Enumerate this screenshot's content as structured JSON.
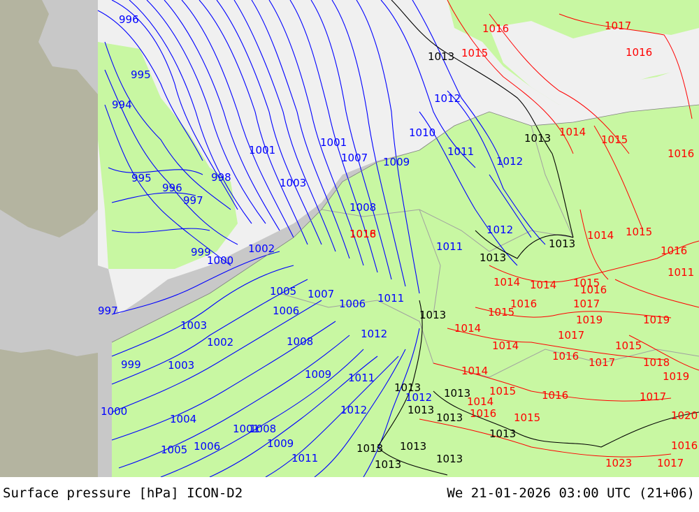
{
  "map": {
    "colors": {
      "outside_domain": "#c8c8c8",
      "land_outside": "#b4b4a0",
      "sea": "#f0f0f0",
      "land": "#c8f7a2",
      "isobar_blue": "#0000ff",
      "isobar_black": "#000000",
      "isobar_red": "#ff0000",
      "border": "#a0a0a0"
    },
    "isobar_labels": [
      {
        "text": "996",
        "color": "blue"
      },
      {
        "text": "995",
        "color": "blue"
      },
      {
        "text": "994",
        "color": "blue"
      },
      {
        "text": "995",
        "color": "blue"
      },
      {
        "text": "996",
        "color": "blue"
      },
      {
        "text": "997",
        "color": "blue"
      },
      {
        "text": "998",
        "color": "blue"
      },
      {
        "text": "999",
        "color": "blue"
      },
      {
        "text": "1000",
        "color": "blue"
      },
      {
        "text": "997",
        "color": "blue"
      },
      {
        "text": "999",
        "color": "blue"
      },
      {
        "text": "1000",
        "color": "blue"
      },
      {
        "text": "1001",
        "color": "blue"
      },
      {
        "text": "1002",
        "color": "blue"
      },
      {
        "text": "1003",
        "color": "blue"
      },
      {
        "text": "1004",
        "color": "blue"
      },
      {
        "text": "1003",
        "color": "blue"
      },
      {
        "text": "1005",
        "color": "blue"
      },
      {
        "text": "1006",
        "color": "blue"
      },
      {
        "text": "1001",
        "color": "blue"
      },
      {
        "text": "1003",
        "color": "blue"
      },
      {
        "text": "1006",
        "color": "blue"
      },
      {
        "text": "1007",
        "color": "blue"
      },
      {
        "text": "1002",
        "color": "blue"
      },
      {
        "text": "1005",
        "color": "blue"
      },
      {
        "text": "1006",
        "color": "blue"
      },
      {
        "text": "1007",
        "color": "blue"
      },
      {
        "text": "1008",
        "color": "blue"
      },
      {
        "text": "1009",
        "color": "blue"
      },
      {
        "text": "1010",
        "color": "blue"
      },
      {
        "text": "1011",
        "color": "blue"
      },
      {
        "text": "1012",
        "color": "blue"
      },
      {
        "text": "1012",
        "color": "blue"
      },
      {
        "text": "1012",
        "color": "blue"
      },
      {
        "text": "1011",
        "color": "blue"
      },
      {
        "text": "1011",
        "color": "blue"
      },
      {
        "text": "1012",
        "color": "blue"
      },
      {
        "text": "1008",
        "color": "blue"
      },
      {
        "text": "1009",
        "color": "blue"
      },
      {
        "text": "1011",
        "color": "blue"
      },
      {
        "text": "1012",
        "color": "blue"
      },
      {
        "text": "1012",
        "color": "blue"
      },
      {
        "text": "1001",
        "color": "blue"
      },
      {
        "text": "1008",
        "color": "blue"
      },
      {
        "text": "1009",
        "color": "blue"
      },
      {
        "text": "1011",
        "color": "blue"
      },
      {
        "text": "1013",
        "color": "black"
      },
      {
        "text": "1013",
        "color": "black"
      },
      {
        "text": "1013",
        "color": "black"
      },
      {
        "text": "1013",
        "color": "black"
      },
      {
        "text": "1013",
        "color": "black"
      },
      {
        "text": "1013",
        "color": "black"
      },
      {
        "text": "1013",
        "color": "black"
      },
      {
        "text": "1013",
        "color": "black"
      },
      {
        "text": "1013",
        "color": "black"
      },
      {
        "text": "1013",
        "color": "black"
      },
      {
        "text": "1013",
        "color": "black"
      },
      {
        "text": "1013",
        "color": "black"
      },
      {
        "text": "1013",
        "color": "black"
      },
      {
        "text": "1013",
        "color": "black"
      },
      {
        "text": "1016",
        "color": "red"
      },
      {
        "text": "1017",
        "color": "red"
      },
      {
        "text": "1016",
        "color": "red"
      },
      {
        "text": "1015",
        "color": "red"
      },
      {
        "text": "1014",
        "color": "red"
      },
      {
        "text": "1015",
        "color": "red"
      },
      {
        "text": "1016",
        "color": "red"
      },
      {
        "text": "1014",
        "color": "red"
      },
      {
        "text": "1015",
        "color": "red"
      },
      {
        "text": "1016",
        "color": "red"
      },
      {
        "text": "1011",
        "color": "red"
      },
      {
        "text": "1014",
        "color": "red"
      },
      {
        "text": "1014",
        "color": "red"
      },
      {
        "text": "1015",
        "color": "red"
      },
      {
        "text": "1016",
        "color": "red"
      },
      {
        "text": "1016",
        "color": "red"
      },
      {
        "text": "1017",
        "color": "red"
      },
      {
        "text": "1015",
        "color": "red"
      },
      {
        "text": "1019",
        "color": "red"
      },
      {
        "text": "1019",
        "color": "red"
      },
      {
        "text": "1014",
        "color": "red"
      },
      {
        "text": "1017",
        "color": "red"
      },
      {
        "text": "1014",
        "color": "red"
      },
      {
        "text": "1016",
        "color": "red"
      },
      {
        "text": "1015",
        "color": "red"
      },
      {
        "text": "1017",
        "color": "red"
      },
      {
        "text": "1018",
        "color": "red"
      },
      {
        "text": "1019",
        "color": "red"
      },
      {
        "text": "1014",
        "color": "red"
      },
      {
        "text": "1015",
        "color": "red"
      },
      {
        "text": "1016",
        "color": "red"
      },
      {
        "text": "1017",
        "color": "red"
      },
      {
        "text": "1014",
        "color": "red"
      },
      {
        "text": "1016",
        "color": "red"
      },
      {
        "text": "1015",
        "color": "red"
      },
      {
        "text": "1016",
        "color": "red"
      },
      {
        "text": "1017",
        "color": "red"
      },
      {
        "text": "1020",
        "color": "red"
      },
      {
        "text": "1023",
        "color": "red"
      },
      {
        "text": "1016",
        "color": "red"
      },
      {
        "text": "1018",
        "color": "red"
      }
    ]
  },
  "footer": {
    "left_title": "Surface pressure [hPa] ICON-D2",
    "right_title": "We 21-01-2026 03:00 UTC (21+06)"
  }
}
